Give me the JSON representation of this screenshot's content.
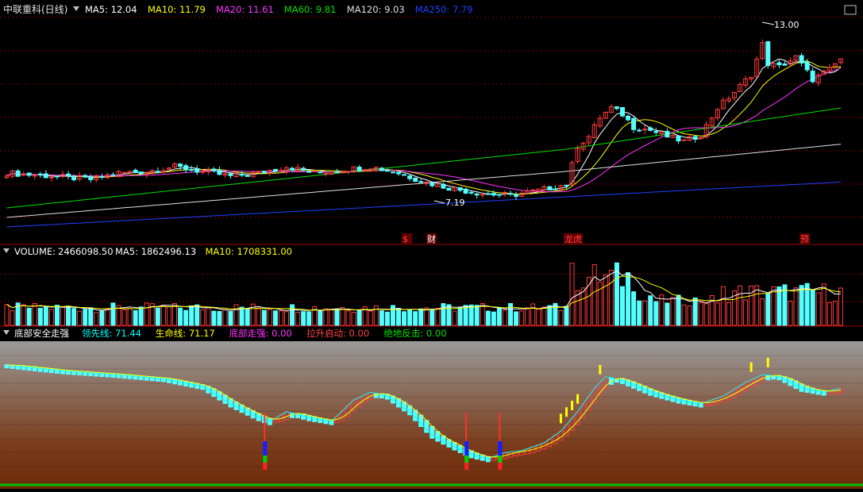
{
  "stock": {
    "name": "中联重科",
    "period": "(日线)",
    "period_icon": "dropdown-arrow-icon"
  },
  "price_panel": {
    "indicators": [
      {
        "label": "MA5:",
        "value": "12.04",
        "color": "#ffffff"
      },
      {
        "label": "MA10:",
        "value": "11.79",
        "color": "#ffff00"
      },
      {
        "label": "MA20:",
        "value": "11.61",
        "color": "#ff33ff"
      },
      {
        "label": "MA60:",
        "value": "9.81",
        "color": "#00e000"
      },
      {
        "label": "MA120:",
        "value": "9.03",
        "color": "#e0e0e0"
      },
      {
        "label": "MA250:",
        "value": "7.79",
        "color": "#2040ff"
      }
    ],
    "high_label": "13.00",
    "low_label": "7.19",
    "event_markers": [
      "$",
      "财",
      "龙虎",
      "预"
    ]
  },
  "volume_panel": {
    "title": "VOLUME:",
    "value": "2466098.50",
    "indicators": [
      {
        "label": "MA5:",
        "value": "1862496.13",
        "color": "#ffffff"
      },
      {
        "label": "MA10:",
        "value": "1708331.00",
        "color": "#ffff00"
      }
    ]
  },
  "signal_panel": {
    "title": "底部安全走强",
    "indicators": [
      {
        "label": "领先线:",
        "value": "71.44",
        "color": "#00ffff"
      },
      {
        "label": "生命线:",
        "value": "71.17",
        "color": "#ffff00"
      },
      {
        "label": "底部走强:",
        "value": "0.00",
        "color": "#ff33ff"
      },
      {
        "label": "拉升启动:",
        "value": "0.00",
        "color": "#ff4040"
      },
      {
        "label": "绝地反击:",
        "value": "0.00",
        "color": "#00e000"
      }
    ]
  },
  "colors": {
    "up": "#ff3b3b",
    "down": "#54ffff",
    "grid": "#7a0000",
    "separator": "#a00000"
  }
}
